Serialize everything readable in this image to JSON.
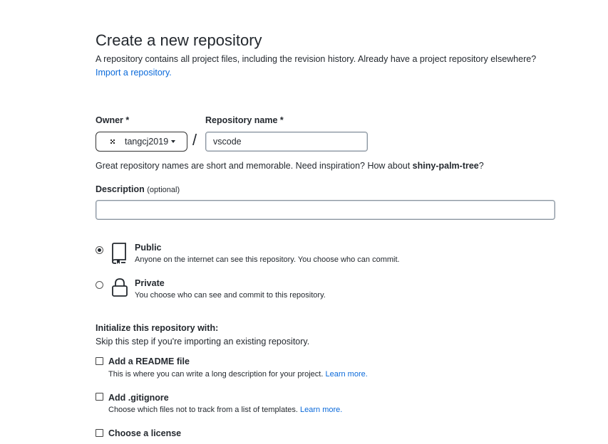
{
  "page": {
    "title": "Create a new repository",
    "subtitle": "A repository contains all project files, including the revision history. Already have a project repository elsewhere?",
    "import_link": "Import a repository."
  },
  "owner": {
    "label": "Owner *",
    "value": "tangcj2019",
    "avatar_icon": "identicon-avatar"
  },
  "slash": "/",
  "repo_name": {
    "label": "Repository name *",
    "value": "vscode"
  },
  "name_hint": {
    "text": "Great repository names are short and memorable. Need inspiration? How about ",
    "suggestion": "shiny-palm-tree",
    "end": "?"
  },
  "description": {
    "label": "Description",
    "optional": "(optional)",
    "value": ""
  },
  "visibility": {
    "public": {
      "title": "Public",
      "desc": "Anyone on the internet can see this repository. You choose who can commit.",
      "icon": "repo-icon",
      "checked": true
    },
    "private": {
      "title": "Private",
      "desc": "You choose who can see and commit to this repository.",
      "icon": "lock-icon",
      "checked": false
    }
  },
  "init": {
    "heading": "Initialize this repository with:",
    "sub": "Skip this step if you're importing an existing repository.",
    "readme": {
      "title": "Add a README file",
      "desc": "This is where you can write a long description for your project.",
      "link": "Learn more."
    },
    "gitignore": {
      "title": "Add .gitignore",
      "desc": "Choose which files not to track from a list of templates.",
      "link": "Learn more."
    },
    "license": {
      "title": "Choose a license"
    }
  },
  "colors": {
    "link": "#0969da",
    "text": "#24292f"
  }
}
